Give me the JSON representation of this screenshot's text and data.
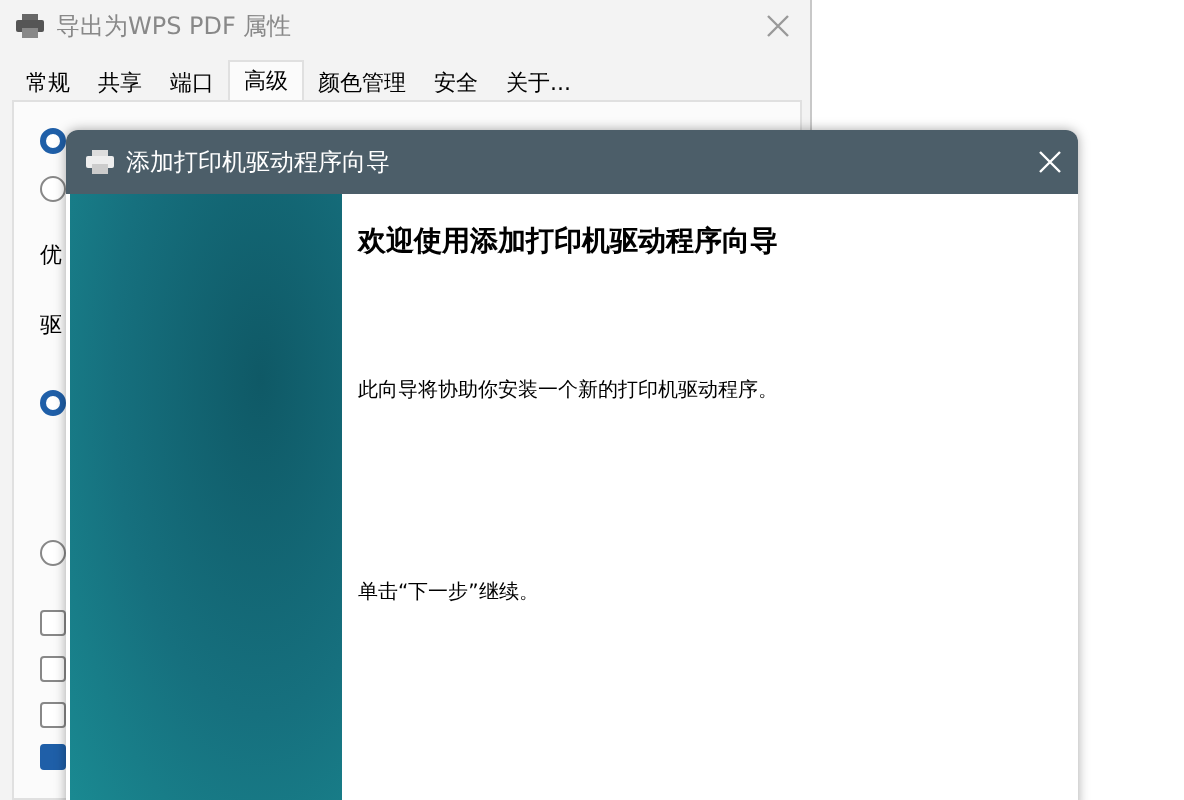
{
  "back_window": {
    "title": "导出为WPS PDF 属性",
    "tabs": [
      {
        "label": "常规",
        "selected": false
      },
      {
        "label": "共享",
        "selected": false
      },
      {
        "label": "端口",
        "selected": false
      },
      {
        "label": "高级",
        "selected": true
      },
      {
        "label": "颜色管理",
        "selected": false
      },
      {
        "label": "安全",
        "selected": false
      },
      {
        "label": "关于...",
        "selected": false
      }
    ],
    "items": [
      {
        "kind": "radio",
        "checked": true
      },
      {
        "kind": "radio",
        "checked": false
      },
      {
        "kind": "text",
        "text": "优"
      },
      {
        "kind": "text",
        "text": "驱"
      },
      {
        "kind": "radio",
        "checked": true
      },
      {
        "kind": "radio",
        "checked": false
      },
      {
        "kind": "checkbox",
        "checked": false
      },
      {
        "kind": "checkbox",
        "checked": false
      },
      {
        "kind": "checkbox",
        "checked": false
      },
      {
        "kind": "checkbox",
        "checked": true
      }
    ]
  },
  "wizard": {
    "title": "添加打印机驱动程序向导",
    "heading": "欢迎使用添加打印机驱动程序向导",
    "paragraphs": [
      "此向导将协助你安装一个新的打印机驱动程序。",
      "单击“下一步”继续。"
    ]
  }
}
